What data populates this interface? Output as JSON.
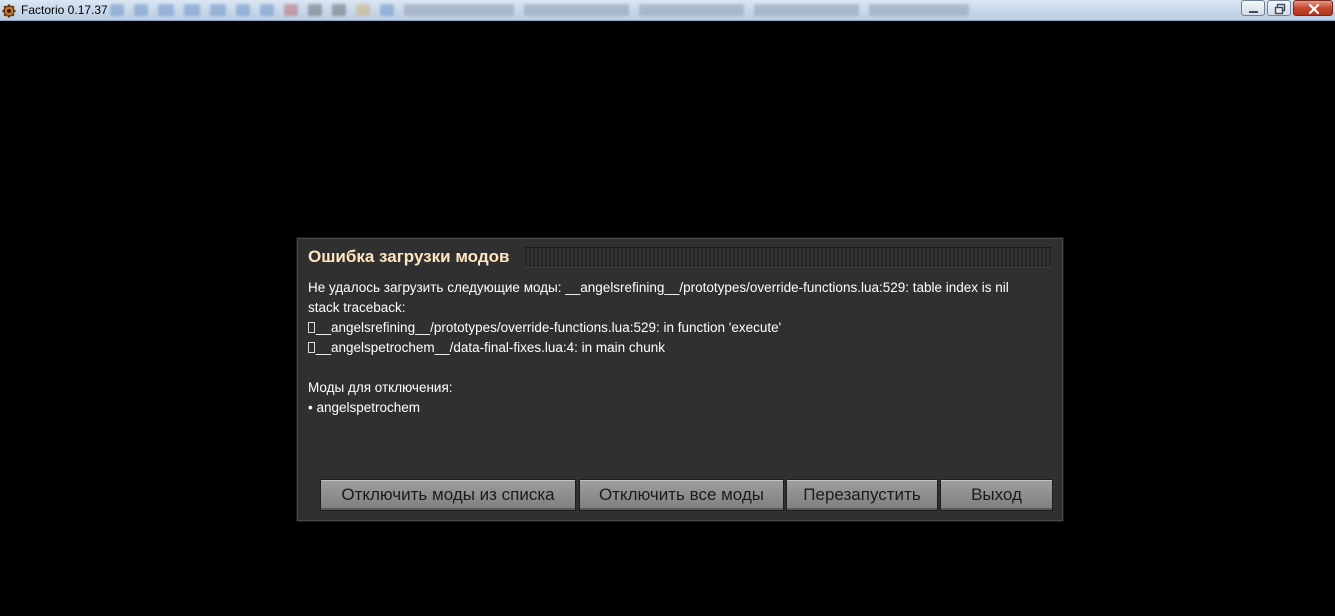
{
  "window": {
    "title": "Factorio 0.17.37",
    "icon": "factorio-gear-icon"
  },
  "dialog": {
    "title": "Ошибка загрузки модов",
    "message_lines": [
      "Не удалось загрузить следующие моды: __angelsrefining__/prototypes/override-functions.lua:529: table index is nil",
      "stack traceback:"
    ],
    "traceback_lines": [
      "__angelsrefining__/prototypes/override-functions.lua:529: in function 'execute'",
      "__angelspetrochem__/data-final-fixes.lua:4: in main chunk"
    ],
    "disable_header": "Моды для отключения:",
    "disable_list": [
      "• angelspetrochem"
    ],
    "buttons": {
      "disable_listed": "Отключить моды из списка",
      "disable_all": "Отключить все моды",
      "restart": "Перезапустить",
      "exit": "Выход"
    }
  },
  "colors": {
    "background": "#000000",
    "dialog_bg": "#313031",
    "title_text": "#ffe6c0",
    "body_text": "#ffffff",
    "button_bg": "#8c8b8c"
  }
}
